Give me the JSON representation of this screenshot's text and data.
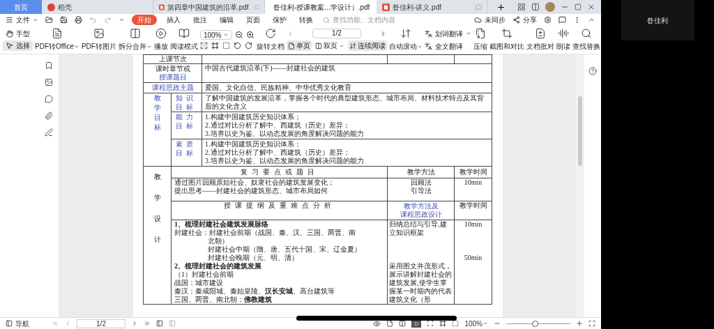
{
  "tabs": [
    {
      "label": "首页",
      "kind": "home",
      "selected": false
    },
    {
      "label": "稻壳",
      "kind": "docer",
      "selected": false
    },
    {
      "label": "第四章中国建筑的沿革.pdf",
      "kind": "pdf",
      "selected": false
    },
    {
      "label": "昝佳利-授课教案...学设计）.pdf",
      "kind": "pdf",
      "selected": true
    },
    {
      "label": "昝佳利-讲义.pdf",
      "kind": "pdf",
      "selected": false
    }
  ],
  "menu": {
    "file": "文件",
    "items": [
      {
        "label": "开始",
        "selected": true
      },
      {
        "label": "插入",
        "selected": false
      },
      {
        "label": "批注",
        "selected": false
      },
      {
        "label": "编辑",
        "selected": false
      },
      {
        "label": "页面",
        "selected": false
      },
      {
        "label": "保护",
        "selected": false
      },
      {
        "label": "转换",
        "selected": false
      }
    ],
    "search": {
      "placeholder": "查找功能、文档内容"
    },
    "sync": "未同步",
    "share": "分享"
  },
  "toolbar": {
    "pointer_tools": [
      {
        "label": "手型",
        "selected": false
      },
      {
        "label": "选择",
        "selected": true
      }
    ],
    "convert_tools": [
      {
        "label": "PDF转Office",
        "dropdown": true
      },
      {
        "label": "PDF转图片",
        "dropdown": false
      },
      {
        "label": "拆分合并",
        "dropdown": true
      },
      {
        "label": "播放",
        "dropdown": false
      },
      {
        "label": "阅读模式",
        "dropdown": false
      }
    ],
    "zoom": {
      "value": "100%"
    },
    "rotate": {
      "label": "旋转文档"
    },
    "page": {
      "value": "1/2"
    },
    "view_modes": [
      {
        "label": "单页",
        "selected": true,
        "dropdown": false
      },
      {
        "label": "双页",
        "selected": false,
        "dropdown": true
      }
    ],
    "continuous": {
      "label": "连续阅读",
      "on": true
    },
    "auto_scroll": {
      "label": "自动滚动",
      "dropdown": true
    },
    "translate_tools": [
      {
        "label": "划词翻译",
        "dropdown": true
      },
      {
        "label": "全文翻译",
        "dropdown": false
      }
    ],
    "tools": [
      {
        "label": "压缩"
      },
      {
        "label": "截图和对比"
      },
      {
        "label": "文档批对"
      },
      {
        "label": "朗读"
      },
      {
        "label": "查找替换"
      }
    ]
  },
  "document": {
    "top_row": "上课节次",
    "topic": {
      "label_1": "课时章节或",
      "label_2": "授课题目",
      "value": "中国古代建筑沿革(下)——封建社会的建筑"
    },
    "ideology": {
      "label": "课程思政主题",
      "value": "爱国、文化自信、民族精神、中华优秀文化教育"
    },
    "goals": {
      "label": "教学目标",
      "items": [
        {
          "label": "知识目标",
          "lines": [
            "了解中国建筑的发展沿革，掌握各个时代的典型建筑形态、城市布局、材料技术特点及其背后的文化含义"
          ]
        },
        {
          "label": "能力目标",
          "lines": [
            "1.构建中国建筑历史知识体系；",
            "2.通过对比分析了解中、西建筑（历史）差异；",
            "3.培养以史为鉴、以动态发展的角度解决问题的能力"
          ]
        },
        {
          "label": "素质目标",
          "lines": [
            "1.构建中国建筑历史知识体系；",
            "2.通过对比分析了解中、西建筑（历史）差异；",
            "3.培养以史为鉴、以动态发展的角度解决问题的能力"
          ]
        }
      ]
    },
    "design": {
      "label": "教学设计",
      "review_header": {
        "topic": "复习要点或题目",
        "method": "教学方法",
        "time": "教学时间"
      },
      "review": {
        "lines": [
          "通过图片回顾原始社会、奴隶社会的建筑发展变化；",
          "提出思考——封建社会的建筑形态、城市布局如何"
        ],
        "methods": [
          "回顾法",
          "引导法"
        ],
        "time": "10min"
      },
      "outline_header": {
        "topic": "授课提纲及重难点分析",
        "method_1": "教学方法及",
        "method_2": "课程思政设计",
        "time": "教学时间"
      },
      "outline": {
        "lines": [
          {
            "kind": "heading",
            "text": "1、梳理封建社会建筑发展脉络"
          },
          {
            "kind": "text",
            "text": "封建社会：封建社会前期（战国、秦、汉、三国、两晋、南"
          },
          {
            "kind": "indent",
            "text": "北朝）"
          },
          {
            "kind": "indent",
            "text": "封建社会中期（隋、唐、五代十国、宋、辽金夏）"
          },
          {
            "kind": "indent",
            "text": "封建社会晚期（元、明、清）"
          },
          {
            "kind": "heading",
            "text": "2、梳理封建社会的建筑发展"
          },
          {
            "kind": "text",
            "text": "（1）封建社会前期"
          },
          {
            "kind": "text",
            "text": "战国：城市建设"
          },
          {
            "kind": "text",
            "text": "秦汉：秦咸阳城、秦始皇陵、**汉长安城**、高台建筑等"
          },
          {
            "kind": "text",
            "text": "三国、两晋、南北朝：**佛教建筑**"
          }
        ],
        "sections": [
          {
            "method": "归纳总结与引导,建立知识框架",
            "time": "10min"
          },
          {
            "method": "采用图文并茂形式，展示讲解封建社会的建筑发展,使学生掌握某一时期内的代表建筑文化（形",
            "time": "50min"
          }
        ]
      }
    }
  },
  "status_bar": {
    "nav": "导航",
    "page": "1/2",
    "zoom": "100%",
    "zoom_slider": {
      "level": 0.45
    }
  },
  "video_tile": {
    "name": "昝佳利"
  }
}
